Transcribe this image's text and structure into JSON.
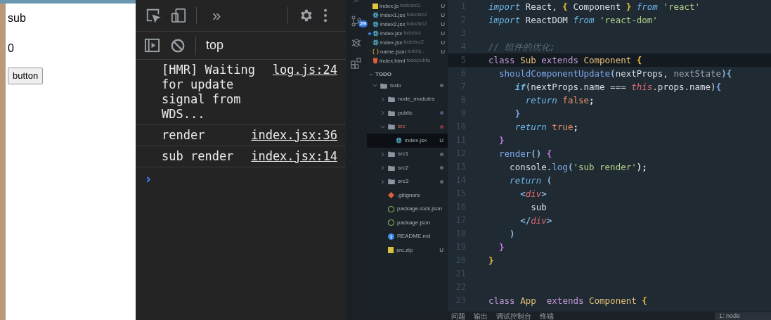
{
  "browser_page": {
    "heading": "sub",
    "count": "0",
    "button": "button"
  },
  "devtools": {
    "more_tabs": "»",
    "context": "top",
    "messages": [
      {
        "text": "[HMR] Waiting for update signal from WDS...",
        "source": "log.js:24"
      },
      {
        "text": "render",
        "source": "index.jsx:36"
      },
      {
        "text": "sub render",
        "source": "index.jsx:14"
      }
    ],
    "prompt": "›"
  },
  "activity_bar": {
    "scm_badge": "29"
  },
  "open_editors": [
    {
      "name": "index.js",
      "path": "todo/src3",
      "kind": "js",
      "status": "U",
      "modified": false
    },
    {
      "name": "index1.jsx",
      "path": "todo/src2",
      "kind": "react",
      "status": "U",
      "modified": false
    },
    {
      "name": "index2.jsx",
      "path": "todo/src2",
      "kind": "react",
      "status": "U",
      "modified": false
    },
    {
      "name": "index.jsx",
      "path": "todo/src",
      "kind": "react",
      "status": "U",
      "modified": true
    },
    {
      "name": "index.jsx",
      "path": "todo/src2",
      "kind": "react",
      "status": "U",
      "modified": false
    },
    {
      "name": "name.json",
      "path": "todo/p...",
      "kind": "json",
      "status": "U",
      "modified": false
    },
    {
      "name": "index.html",
      "path": "todo/public",
      "kind": "html",
      "modified": false
    }
  ],
  "explorer": {
    "title": "TODO",
    "tree": [
      {
        "name": "todo",
        "kind": "folder",
        "expanded": true,
        "selected": false,
        "color": "#5b6670",
        "children": [
          {
            "name": "node_modules",
            "kind": "folder",
            "expanded": false,
            "selected": false
          },
          {
            "name": "public",
            "kind": "folder",
            "expanded": false,
            "selected": false,
            "color": "#4a5a7a"
          },
          {
            "name": "src",
            "kind": "folder",
            "expanded": true,
            "selected": false,
            "color": "#7a3a40",
            "children": [
              {
                "name": "index.jsx",
                "kind": "react",
                "status": "U",
                "selected": true
              }
            ]
          },
          {
            "name": "src1",
            "kind": "folder",
            "expanded": false,
            "selected": false,
            "color": "#5b6670"
          },
          {
            "name": "src2",
            "kind": "folder",
            "expanded": false,
            "selected": false,
            "color": "#5b6670"
          },
          {
            "name": "src3",
            "kind": "folder",
            "expanded": false,
            "selected": false,
            "color": "#5b6670"
          },
          {
            "name": ".gitignore",
            "kind": "git",
            "selected": false
          },
          {
            "name": "package-lock.json",
            "kind": "npm",
            "selected": false
          },
          {
            "name": "package.json",
            "kind": "npm",
            "selected": false
          },
          {
            "name": "README.md",
            "kind": "info",
            "selected": false
          },
          {
            "name": "src.zip",
            "kind": "zip",
            "status": "U",
            "selected": false
          }
        ]
      }
    ]
  },
  "editor": {
    "lines": [
      {
        "n": "1",
        "tokens": [
          {
            "t": "import",
            "color": "#6cb6e8"
          },
          {
            "t": " React,",
            "color": "#d8dee4"
          },
          {
            "t": " {",
            "color": "#f0c040"
          },
          {
            "t": " Component",
            "color": "#d8dee4"
          },
          {
            "t": " }",
            "color": "#f0c040"
          },
          {
            "t": " from",
            "color": "#6cb6e8"
          },
          {
            "t": " 'react'",
            "color": "#b5d08a"
          }
        ]
      },
      {
        "n": "2",
        "tokens": [
          {
            "t": "import",
            "color": "#6cb6e8"
          },
          {
            "t": " ReactDOM",
            "color": "#d8dee4"
          },
          {
            "t": " from",
            "color": "#6cb6e8"
          },
          {
            "t": " 'react-dom'",
            "color": "#b5d08a"
          }
        ]
      },
      {
        "n": "3"
      },
      {
        "n": "4",
        "tokens": [
          {
            "t": "// 组件的优化;",
            "color": "#5c6a76"
          }
        ]
      },
      {
        "n": "5",
        "current": true,
        "tokens": [
          {
            "t": "class",
            "color": "#c39ad8"
          },
          {
            "t": " Sub",
            "color": "#e8c07a"
          },
          {
            "t": " extends",
            "color": "#c39ad8"
          },
          {
            "t": " Component",
            "color": "#e8c07a"
          },
          {
            "t": " {",
            "color": "#f0c040"
          }
        ]
      },
      {
        "n": "6",
        "tokens": [
          {
            "t": "  shouldComponentUpdate",
            "color": "#7fa7e8"
          },
          {
            "t": "(",
            "color": "#8ab8e0"
          },
          {
            "t": "nextProps,",
            "color": "#d8dee4"
          },
          {
            "t": " nextState",
            "color": "#9aa4ae"
          },
          {
            "t": "){",
            "color": "#8ab8e0"
          }
        ]
      },
      {
        "n": "7",
        "tokens": [
          {
            "t": "     if",
            "color": "#6cb6e8"
          },
          {
            "t": "(nextProps.name ===",
            "color": "#d8dee4"
          },
          {
            "t": " this",
            "color": "#e06c75"
          },
          {
            "t": ".props.name)",
            "color": "#d8dee4"
          },
          {
            "t": "{",
            "color": "#7fa7e8"
          }
        ]
      },
      {
        "n": "8",
        "tokens": [
          {
            "t": "       return",
            "color": "#6cb6e8"
          },
          {
            "t": " false",
            "color": "#e8906a"
          },
          {
            "t": ";",
            "color": "#d8dee4"
          }
        ]
      },
      {
        "n": "9",
        "tokens": [
          {
            "t": "     }",
            "color": "#7fa7e8"
          }
        ]
      },
      {
        "n": "10",
        "tokens": [
          {
            "t": "     return",
            "color": "#6cb6e8"
          },
          {
            "t": " true",
            "color": "#e8906a"
          },
          {
            "t": ";",
            "color": "#d8dee4"
          }
        ]
      },
      {
        "n": "11",
        "tokens": [
          {
            "t": "  }",
            "color": "#c678dd"
          }
        ]
      },
      {
        "n": "12",
        "tokens": [
          {
            "t": "  render",
            "color": "#7fa7e8"
          },
          {
            "t": "()",
            "color": "#8ab8e0"
          },
          {
            "t": " {",
            "color": "#c678dd"
          }
        ]
      },
      {
        "n": "13",
        "tokens": [
          {
            "t": "    console.",
            "color": "#d8dee4"
          },
          {
            "t": "log",
            "color": "#7fa7e8"
          },
          {
            "t": "(",
            "color": "#8ab8e0"
          },
          {
            "t": "'sub render'",
            "color": "#b5d08a"
          },
          {
            "t": ");",
            "color": "#d8dee4"
          }
        ]
      },
      {
        "n": "14",
        "tokens": [
          {
            "t": "    return",
            "color": "#6cb6e8"
          },
          {
            "t": " (",
            "color": "#8ab8e0"
          }
        ]
      },
      {
        "n": "15",
        "tokens": [
          {
            "t": "      <",
            "color": "#8ab8e0"
          },
          {
            "t": "div",
            "color": "#e06c75"
          },
          {
            "t": ">",
            "color": "#8ab8e0"
          }
        ]
      },
      {
        "n": "16",
        "tokens": [
          {
            "t": "        sub",
            "color": "#d8dee4"
          }
        ]
      },
      {
        "n": "17",
        "tokens": [
          {
            "t": "      </",
            "color": "#8ab8e0"
          },
          {
            "t": "div",
            "color": "#e06c75"
          },
          {
            "t": ">",
            "color": "#8ab8e0"
          }
        ]
      },
      {
        "n": "18",
        "tokens": [
          {
            "t": "    )",
            "color": "#8ab8e0"
          }
        ]
      },
      {
        "n": "19",
        "tokens": [
          {
            "t": "  }",
            "color": "#c678dd"
          }
        ]
      },
      {
        "n": "20",
        "tokens": [
          {
            "t": "}",
            "color": "#f0c040"
          }
        ]
      },
      {
        "n": "21"
      },
      {
        "n": "22"
      },
      {
        "n": "23",
        "tokens": [
          {
            "t": "class",
            "color": "#c39ad8"
          },
          {
            "t": " App",
            "color": "#e8c07a"
          },
          {
            "t": "  extends",
            "color": "#c39ad8"
          },
          {
            "t": " Component",
            "color": "#e8c07a"
          },
          {
            "t": " {",
            "color": "#f0c040"
          }
        ]
      }
    ]
  },
  "panel": {
    "tabs": [
      "问题",
      "输出",
      "调试控制台",
      "终端"
    ],
    "terminal": "1: node"
  }
}
